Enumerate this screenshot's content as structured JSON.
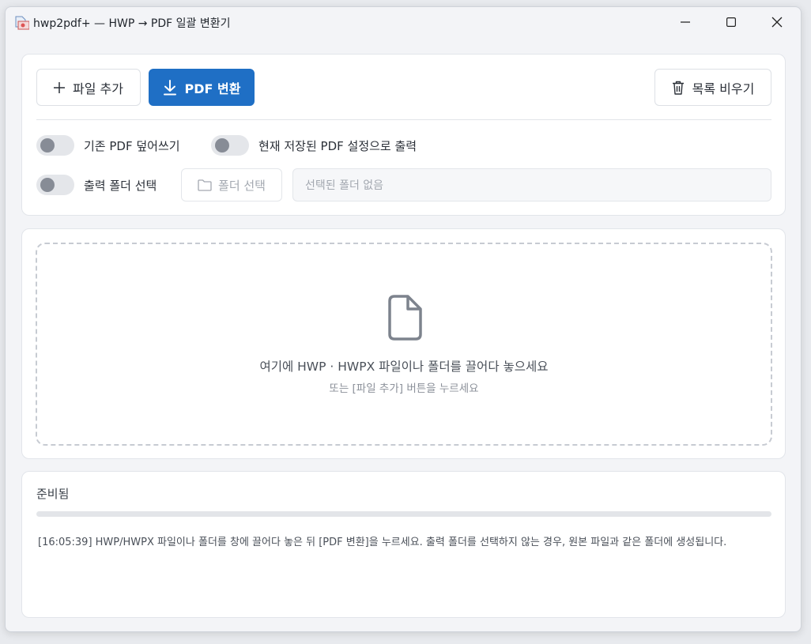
{
  "window": {
    "title": "hwp2pdf+ — HWP → PDF 일괄 변환기"
  },
  "toolbar": {
    "add_file_label": "파일 추가",
    "convert_label": "PDF 변환",
    "clear_label": "목록 비우기"
  },
  "options": {
    "overwrite_label": "기존 PDF 덮어쓰기",
    "overwrite_on": false,
    "saved_settings_label": "현재 저장된 PDF 설정으로 출력",
    "saved_settings_on": false,
    "output_folder_label": "출력 폴더 선택",
    "output_folder_on": false,
    "folder_button_label": "폴더 선택",
    "folder_path_placeholder": "선택된 폴더 없음"
  },
  "dropzone": {
    "main_text": "여기에 HWP · HWPX 파일이나 폴더를 끌어다 놓으세요",
    "sub_text": "또는 [파일 추가] 버튼을 누르세요"
  },
  "status": {
    "label": "준비됨",
    "progress": 0,
    "log": "[16:05:39] HWP/HWPX 파일이나 폴더를 창에 끌어다 놓은 뒤 [PDF 변환]을 누르세요. 출력 폴더를 선택하지 않는 경우, 원본 파일과 같은 폴더에 생성됩니다."
  },
  "colors": {
    "accent": "#1f6fc5",
    "toggle_off_track": "#e4e6ea",
    "toggle_off_knob": "#878c96"
  }
}
